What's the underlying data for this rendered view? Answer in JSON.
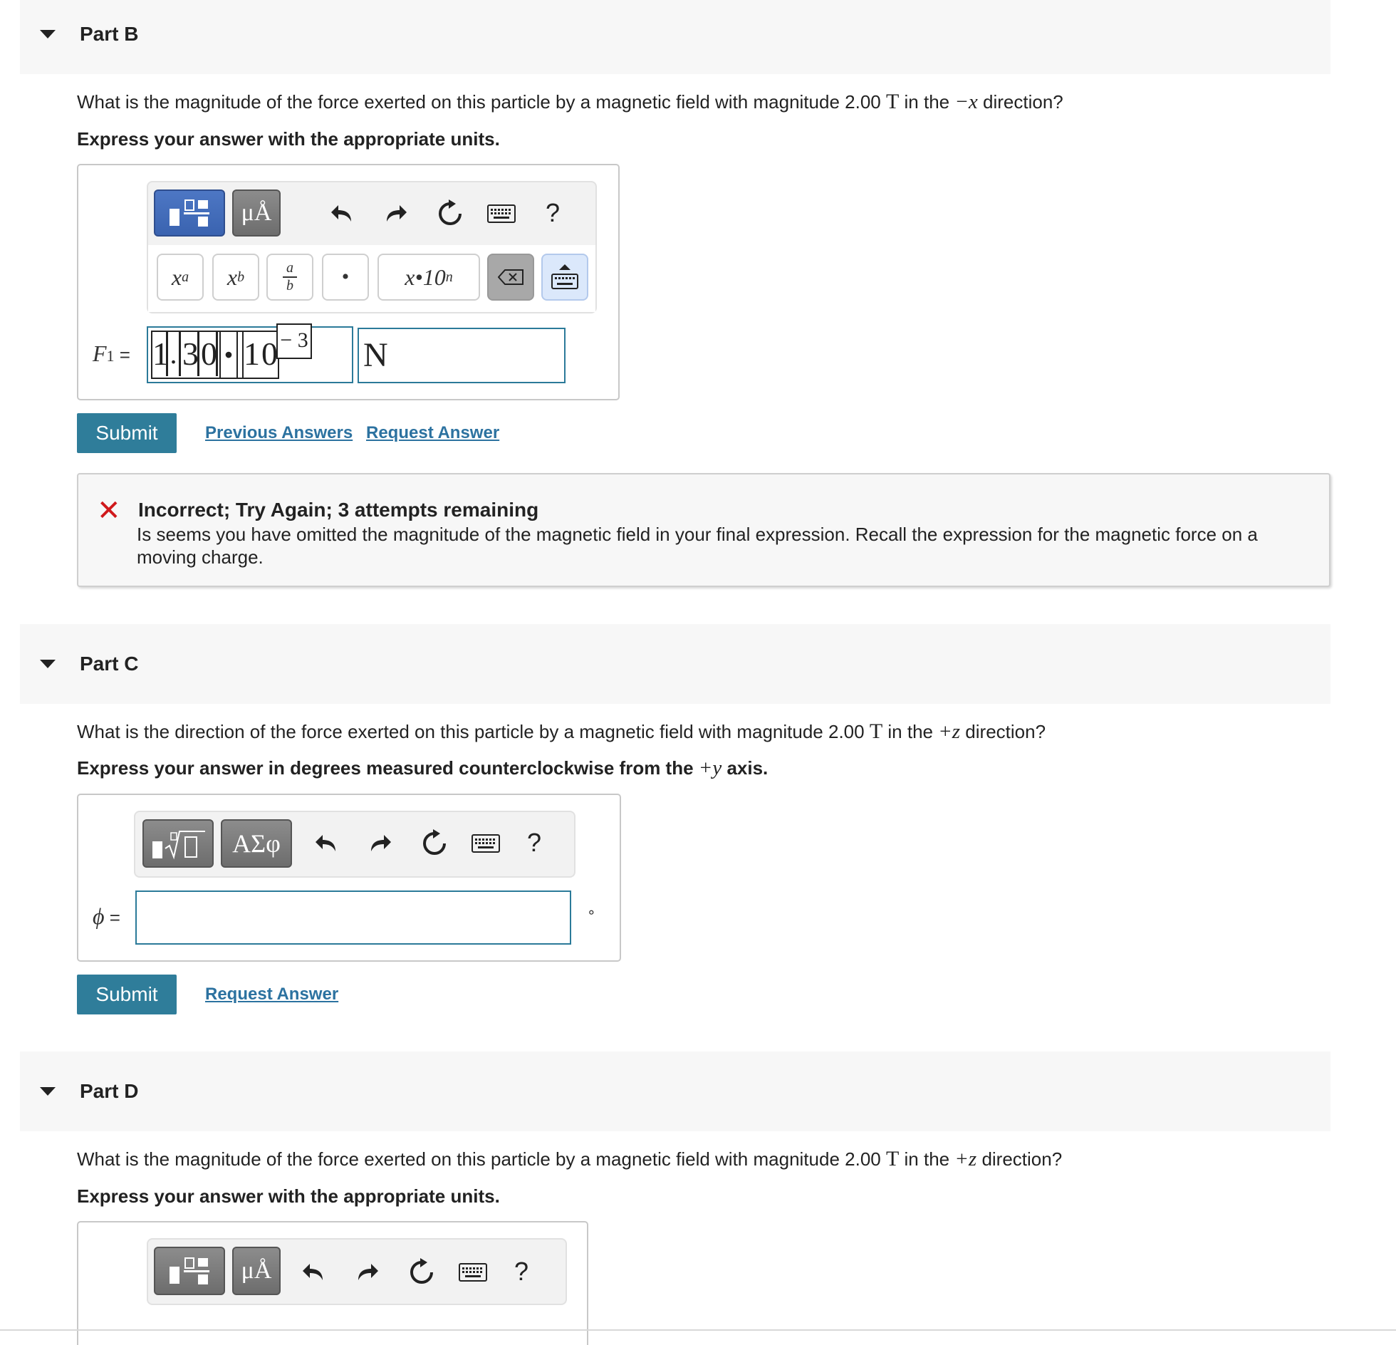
{
  "partB": {
    "title": "Part B",
    "question": {
      "before": "What is the magnitude of the force exerted on this particle by a magnetic field with magnitude 2.00 ",
      "unit": "T",
      "middle": " in the ",
      "direction": "−x",
      "after": " direction?"
    },
    "instruction": "Express your answer with the appropriate units.",
    "toolbar": {
      "templates_icon": "fraction-template-icon",
      "units_label": "μÅ",
      "undo_icon": "undo-icon",
      "redo_icon": "redo-icon",
      "reset_icon": "reset-icon",
      "keyboard_icon": "keyboard-icon",
      "help_label": "?"
    },
    "keys": {
      "superscript": "xa",
      "subscript": "xb",
      "fraction_num": "a",
      "fraction_den": "b",
      "dot": "•",
      "sci_label": "x•10n",
      "backspace_icon": "backspace-icon",
      "keyboard_toggle_icon": "keyboard-toggle-icon"
    },
    "variable": "F1 =",
    "value_mantissa_digits": [
      "1",
      ".",
      "3",
      "0"
    ],
    "value_times": "•",
    "value_base": "10",
    "value_exponent": "− 3",
    "unit_value": "N",
    "submit_label": "Submit",
    "previous_answers_label": "Previous Answers",
    "request_answer_label": "Request Answer",
    "feedback": {
      "status_icon": "x-mark-icon",
      "title": "Incorrect; Try Again; 3 attempts remaining",
      "body": "Is seems you have omitted the magnitude of the magnetic field in your final expression. Recall the expression for the magnetic force on a moving charge."
    }
  },
  "partC": {
    "title": "Part C",
    "question": {
      "before": "What is the direction of the force exerted on this particle by a magnetic field with magnitude 2.00 ",
      "unit": "T",
      "middle": " in the ",
      "direction": "+z",
      "after": " direction?"
    },
    "instruction": {
      "before": "Express your answer in degrees measured counterclockwise from the ",
      "axis": "+y",
      "after": " axis."
    },
    "toolbar": {
      "templates_icon": "radical-template-icon",
      "symbols_label": "ΑΣφ",
      "help_label": "?"
    },
    "variable": "ϕ =",
    "input_value": "",
    "unit_label": "∘",
    "submit_label": "Submit",
    "request_answer_label": "Request Answer"
  },
  "partD": {
    "title": "Part D",
    "question": {
      "before": "What is the magnitude of the force exerted on this particle by a magnetic field with magnitude 2.00 ",
      "unit": "T",
      "middle": " in the ",
      "direction": "+z",
      "after": " direction?"
    },
    "instruction": "Express your answer with the appropriate units.",
    "toolbar": {
      "units_label": "μÅ",
      "help_label": "?"
    }
  },
  "colors": {
    "submit": "#2f7d9a",
    "link": "#2c72a0",
    "error": "#d0191c",
    "active_template": "#3a63b0"
  }
}
